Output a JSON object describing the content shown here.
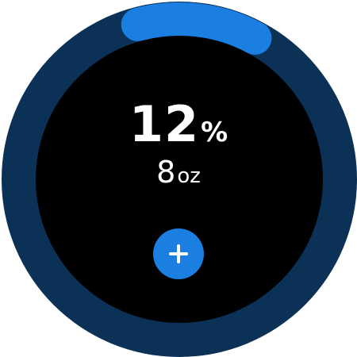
{
  "progress": {
    "percent_value": "12",
    "percent_unit": "%",
    "fraction": 0.12,
    "track_color": "#0b3157",
    "fill_color": "#1a7fe0",
    "background_color": "#000000"
  },
  "intake": {
    "value": "8",
    "unit": "oz"
  },
  "add_button": {
    "icon": "plus-icon",
    "color": "#1a7fe0"
  }
}
